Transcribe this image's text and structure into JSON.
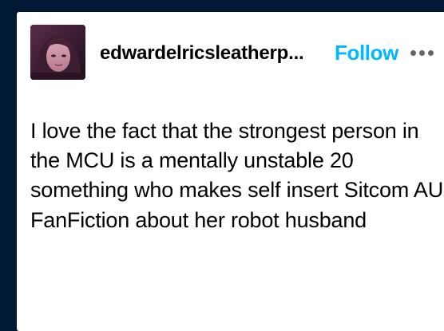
{
  "post": {
    "blog_name": "edwardelricsleatherp...",
    "follow_label": "Follow",
    "more_icon": "ellipsis-icon",
    "avatar": "blog-avatar",
    "body_text": "I love the fact that the strongest person in the MCU is a mentally unstable 20 something who makes self insert Sitcom AU FanFiction about her robot husband"
  },
  "colors": {
    "page_background": "#001935",
    "card_background": "#ffffff",
    "follow": "#00b8ff",
    "text": "#000000",
    "icon": "#666666"
  }
}
